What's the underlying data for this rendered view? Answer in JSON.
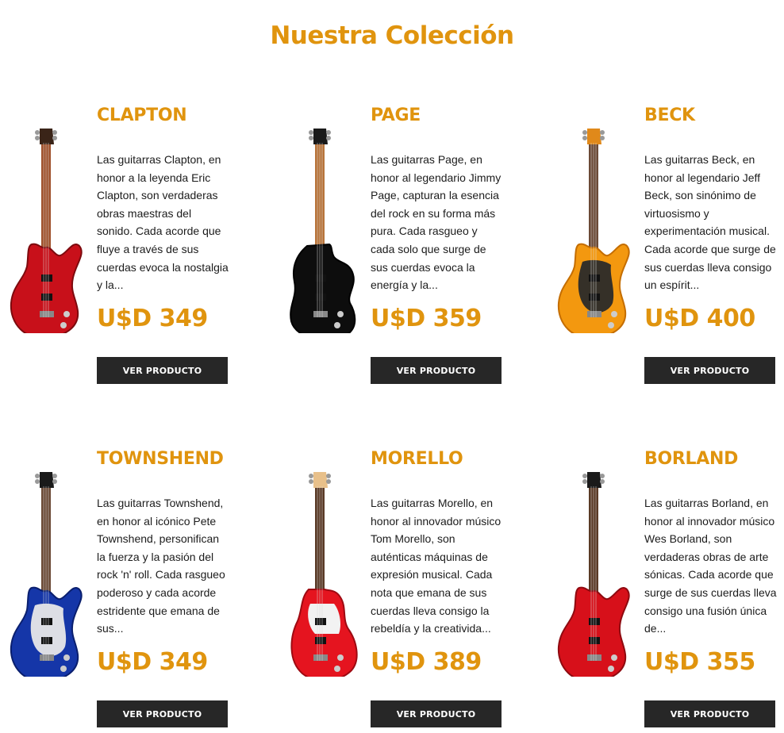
{
  "section_title": "Nuestra Colección",
  "button_label": "VER PRODUCTO",
  "accent_color": "#e0940e",
  "products": [
    {
      "name": "CLAPTON",
      "description": "Las guitarras Clapton, en honor a la leyenda Eric Clapton, son verdaderas obras maestras del sonido. Cada acorde que fluye a través de sus cuerdas evoca la nostalgia y la...",
      "price": "U$D 349",
      "guitar": {
        "body": "#c8101a",
        "body_dark": "#7d0a0e",
        "neck": "#a0522d",
        "head": "#3a2418",
        "pickguard": "#1a1a1a",
        "style": "superstrat"
      }
    },
    {
      "name": "PAGE",
      "description": "Las guitarras Page, en honor al legendario Jimmy Page, capturan la esencia del rock en su forma más pura. Cada rasgueo y cada solo que surge de sus cuerdas evoca la energía y la...",
      "price": "U$D 359",
      "guitar": {
        "body": "#0d0d0d",
        "body_dark": "#000000",
        "neck": "#b8743a",
        "head": "#1a1a1a",
        "pickguard": "#222222",
        "style": "offset"
      }
    },
    {
      "name": "BECK",
      "description": "Las guitarras Beck, en honor al legendario Jeff Beck, son sinónimo de virtuosismo y experimentación musical. Cada acorde que surge de sus cuerdas lleva consigo un espírit...",
      "price": "U$D 400",
      "guitar": {
        "body": "#f3980f",
        "body_dark": "#c46d00",
        "neck": "#6b4a36",
        "head": "#e0891a",
        "pickguard": "#2a2a2a",
        "style": "strat"
      }
    },
    {
      "name": "TOWNSHEND",
      "description": "Las guitarras Townshend, en honor al icónico Pete Townshend, personifican la fuerza y la pasión del rock 'n' roll. Cada rasgueo poderoso y cada acorde estridente que emana de sus...",
      "price": "U$D 349",
      "guitar": {
        "body": "#1536a8",
        "body_dark": "#0a1f6e",
        "neck": "#6b4a36",
        "head": "#1a1a1a",
        "pickguard": "#e8e8e8",
        "style": "strat"
      }
    },
    {
      "name": "MORELLO",
      "description": "Las guitarras Morello, en honor al innovador músico Tom Morello, son auténticas máquinas de expresión musical. Cada nota que emana de sus cuerdas lleva consigo la rebeldía y la creativida...",
      "price": "U$D 389",
      "guitar": {
        "body": "#e5141f",
        "body_dark": "#9e0a12",
        "neck": "#5a3a26",
        "head": "#e8c08a",
        "pickguard": "#f2f2f2",
        "style": "tstyle"
      }
    },
    {
      "name": "BORLAND",
      "description": "Las guitarras Borland, en honor al innovador músico Wes Borland, son verdaderas obras de arte sónicas. Cada acorde que surge de sus cuerdas lleva consigo una fusión única de...",
      "price": "U$D 355",
      "guitar": {
        "body": "#d7101a",
        "body_dark": "#8e0a10",
        "neck": "#5a3a26",
        "head": "#1a1a1a",
        "pickguard": "#1a1a1a",
        "style": "superstrat"
      }
    }
  ]
}
